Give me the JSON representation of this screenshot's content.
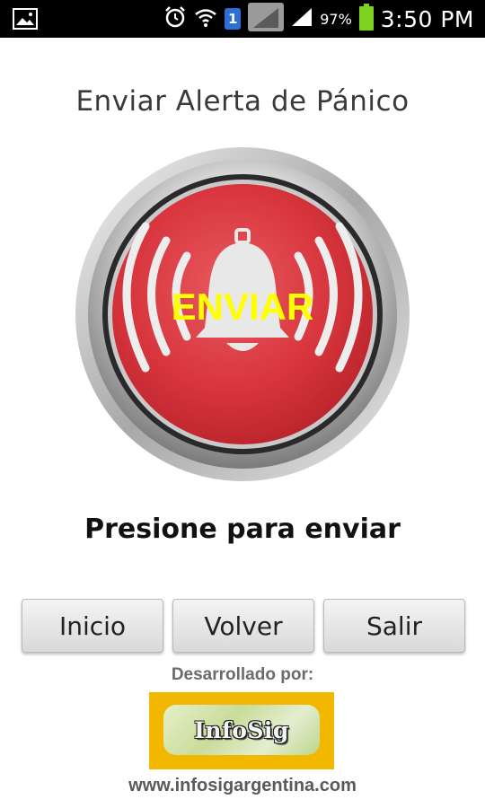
{
  "status_bar": {
    "time": "3:50 PM",
    "battery_percent": "97%",
    "sim_number": "1",
    "icons": [
      "image-icon",
      "alarm-clock-icon",
      "wifi-icon",
      "sim-icon",
      "signal-icon",
      "signal-icon",
      "battery-icon"
    ]
  },
  "screen": {
    "title": "Enviar Alerta de Pánico",
    "alarm_button_label": "ENVIAR",
    "instruction": "Presione para enviar"
  },
  "buttons": {
    "inicio": "Inicio",
    "volver": "Volver",
    "salir": "Salir"
  },
  "footer": {
    "developed_by": "Desarrollado por:",
    "logo_text": "InfoSig",
    "url": "www.infosigargentina.com"
  },
  "colors": {
    "alarm_red": "#d8353d",
    "label_yellow": "#ffff00",
    "logo_gold": "#f2b800",
    "battery_green": "#7ed321"
  }
}
